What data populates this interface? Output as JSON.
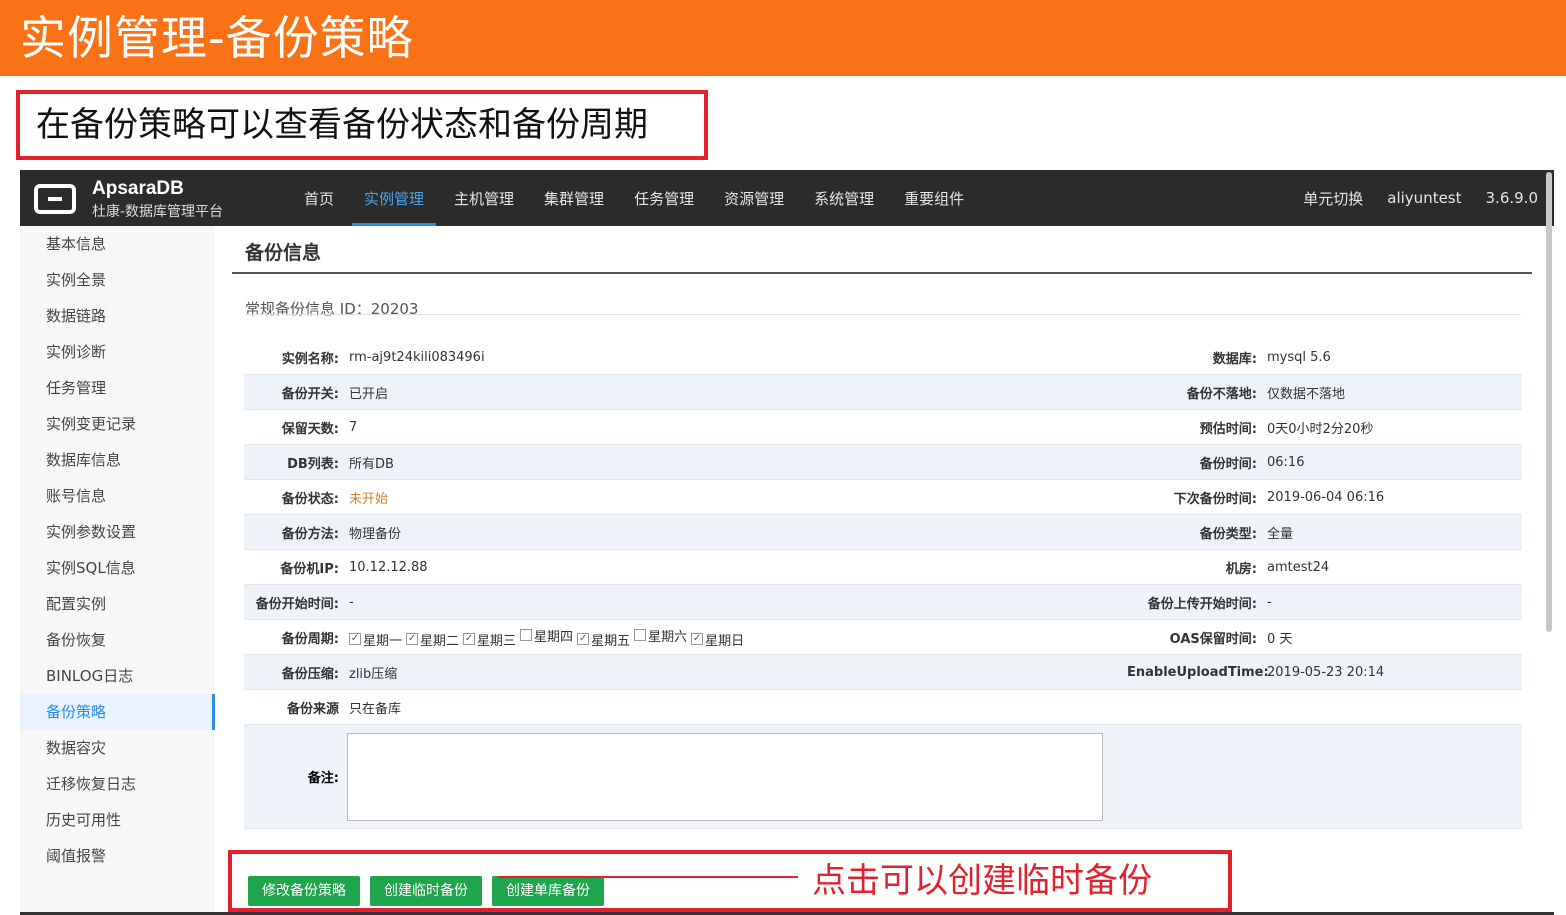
{
  "slide": {
    "title": "实例管理-备份策略",
    "description": "在备份策略可以查看备份状态和备份周期",
    "callout": "点击可以创建临时备份"
  },
  "app": {
    "logo_name": "ApsaraDB",
    "logo_sub": "杜康-数据库管理平台",
    "nav": [
      "首页",
      "实例管理",
      "主机管理",
      "集群管理",
      "任务管理",
      "资源管理",
      "系统管理",
      "重要组件"
    ],
    "active_nav": 1,
    "top_right": {
      "unit_switch": "单元切换 ",
      "user": "aliyuntest ",
      "version": "3.6.9.0"
    }
  },
  "sidebar": {
    "items": [
      "基本信息",
      "实例全景",
      "数据链路",
      "实例诊断",
      "任务管理",
      "实例变更记录",
      "数据库信息",
      "账号信息",
      "实例参数设置",
      "实例SQL信息",
      "配置实例",
      "备份恢复",
      "BINLOG日志",
      "备份策略",
      "数据容灾",
      "迁移恢复日志",
      "历史可用性",
      "阈值报警"
    ],
    "active_index": 13
  },
  "content": {
    "section_title": "备份信息",
    "backup_id": "常规备份信息 ID：20203",
    "rows": [
      {
        "l": "实例名称:",
        "v": "rm-aj9t24kili083496i",
        "rl": "数据库:",
        "rv": "mysql 5.6"
      },
      {
        "l": "备份开关:",
        "v": "已开启",
        "rl": "备份不落地:",
        "rv": "仅数据不落地"
      },
      {
        "l": "保留天数:",
        "v": "7",
        "rl": "预估时间:",
        "rv": "0天0小时2分20秒"
      },
      {
        "l": "DB列表:",
        "v": "所有DB",
        "rl": "备份时间:",
        "rv": "06:16"
      },
      {
        "l": "备份状态:",
        "v": "未开始",
        "rl": "下次备份时间:",
        "rv": "2019-06-04 06:16"
      },
      {
        "l": "备份方法:",
        "v": "物理备份",
        "rl": "备份类型:",
        "rv": "全量"
      },
      {
        "l": "备份机IP:",
        "v": "10.12.12.88",
        "rl": "机房:",
        "rv": "amtest24"
      },
      {
        "l": "备份开始时间:",
        "v": "-",
        "rl": "备份上传开始时间:",
        "rv": "-"
      },
      {
        "l": "备份周期:",
        "v": "",
        "rl": "OAS保留时间:",
        "rv": "0 天"
      },
      {
        "l": "备份压缩:",
        "v": "zlib压缩",
        "rl": "EnableUploadTime:",
        "rv": "2019-05-23 20:14"
      },
      {
        "l": "备份来源",
        "v": "只在备库",
        "rl": "",
        "rv": ""
      }
    ],
    "weekdays": [
      {
        "label": "星期一",
        "checked": true
      },
      {
        "label": "星期二",
        "checked": true
      },
      {
        "label": "星期三",
        "checked": true
      },
      {
        "label": "星期四",
        "checked": false
      },
      {
        "label": "星期五",
        "checked": true
      },
      {
        "label": "星期六",
        "checked": false
      },
      {
        "label": "星期日",
        "checked": true
      }
    ],
    "remark_label": "备注:",
    "buttons": [
      "修改备份策略",
      "创建临时备份",
      "创建单库备份"
    ]
  }
}
